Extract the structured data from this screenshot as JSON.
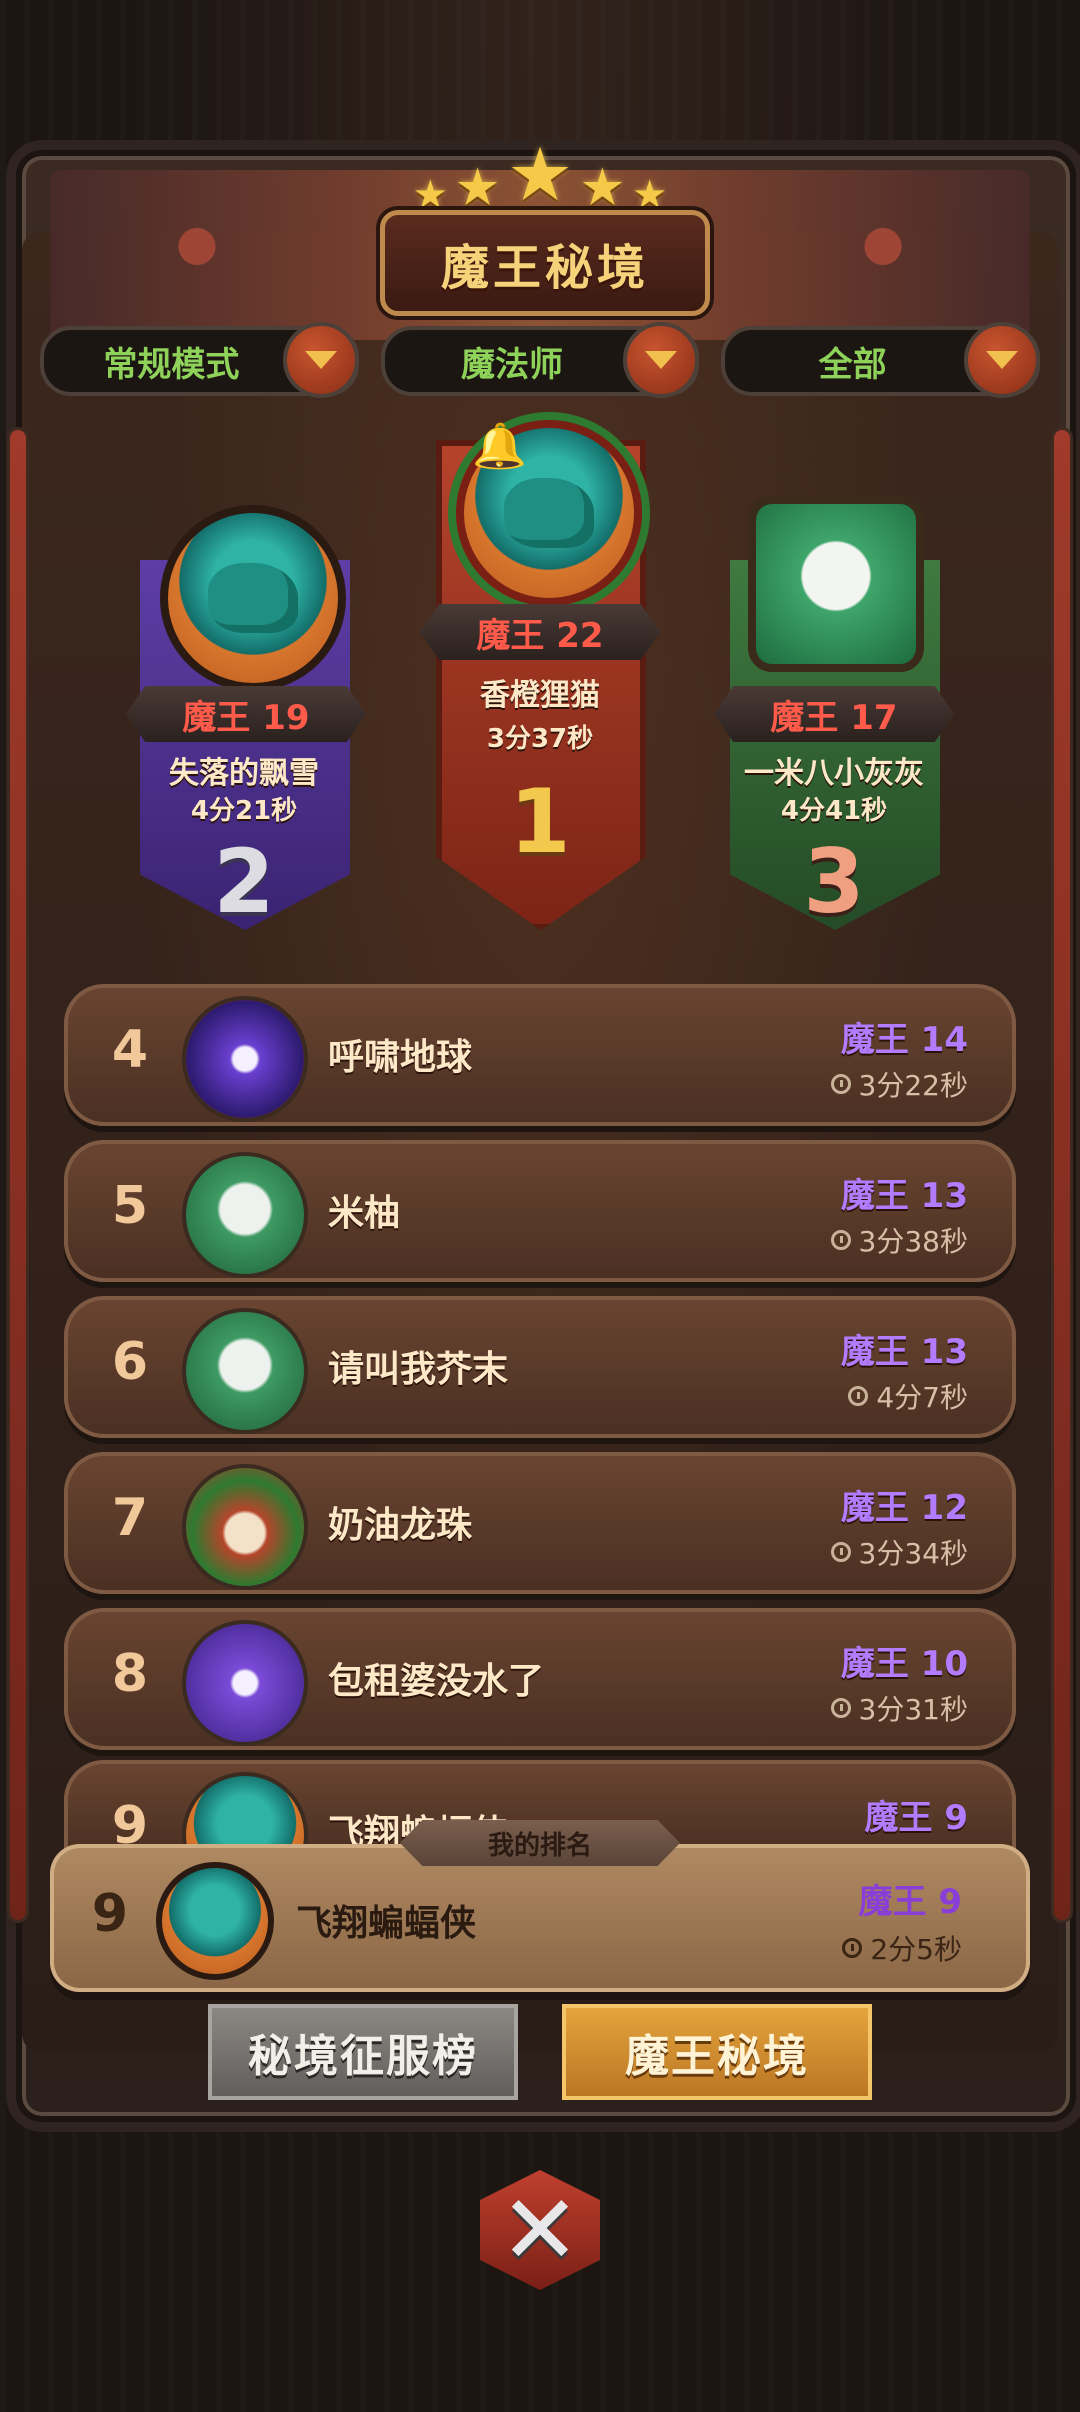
{
  "header": {
    "title": "魔王秘境",
    "stars": 5
  },
  "filters": [
    {
      "label": "常规模式"
    },
    {
      "label": "魔法师"
    },
    {
      "label": "全部"
    }
  ],
  "podium": {
    "first": {
      "rank": "1",
      "level": "魔王 22",
      "name": "香橙狸猫",
      "time": "3分37秒"
    },
    "second": {
      "rank": "2",
      "level": "魔王 19",
      "name": "失落的飘雪",
      "time": "4分21秒"
    },
    "third": {
      "rank": "3",
      "level": "魔王 17",
      "name": "一米八小灰灰",
      "time": "4分41秒"
    }
  },
  "list": [
    {
      "rank": "4",
      "name": "呼啸地球",
      "level": "魔王 14",
      "time": "3分22秒"
    },
    {
      "rank": "5",
      "name": "米柚",
      "level": "魔王 13",
      "time": "3分38秒"
    },
    {
      "rank": "6",
      "name": "请叫我芥末",
      "level": "魔王 13",
      "time": "4分7秒"
    },
    {
      "rank": "7",
      "name": "奶油龙珠",
      "level": "魔王 12",
      "time": "3分34秒"
    },
    {
      "rank": "8",
      "name": "包租婆没水了",
      "level": "魔王 10",
      "time": "3分31秒"
    },
    {
      "rank": "9",
      "name": "飞翔蝙蝠侠",
      "level": "魔王 9",
      "time": ""
    }
  ],
  "my_ranking": {
    "tag": "我的排名",
    "rank": "9",
    "name": "飞翔蝙蝠侠",
    "level": "魔王 9",
    "time": "2分5秒"
  },
  "tabs": [
    {
      "label": "秘境征服榜",
      "active": false
    },
    {
      "label": "魔王秘境",
      "active": true
    }
  ],
  "close_icon": "close-icon"
}
